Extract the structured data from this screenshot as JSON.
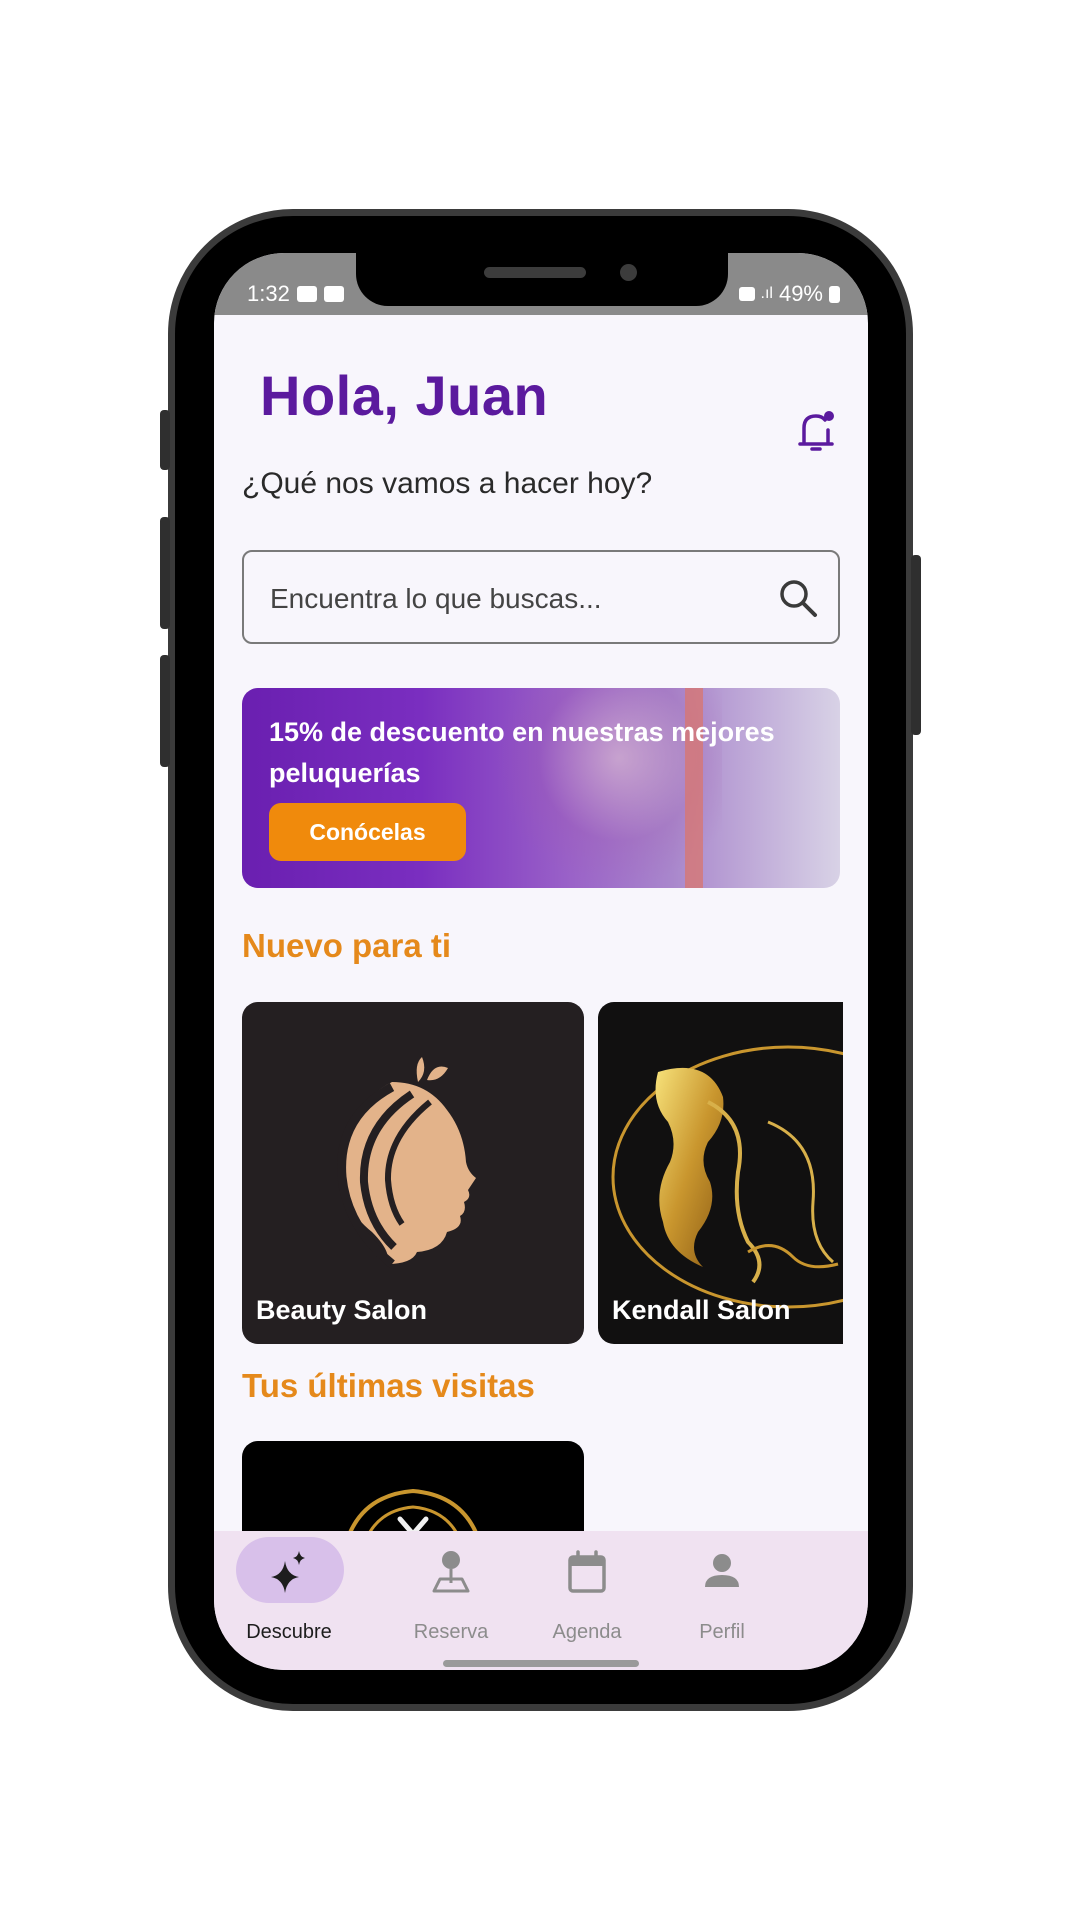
{
  "status_bar": {
    "time": "1:32",
    "battery": "49%"
  },
  "header": {
    "greeting": "Hola, Juan",
    "subtitle": "¿Qué nos vamos a hacer hoy?"
  },
  "search": {
    "placeholder": "Encuentra lo que buscas...",
    "icon": "search-icon"
  },
  "promo": {
    "text": "15% de descuento en nuestras mejores peluquerías",
    "button_label": "Conócelas"
  },
  "sections": {
    "new_for_you": "Nuevo para ti",
    "recent_visits": "Tus últimas visitas"
  },
  "new_salons": [
    {
      "name": "Beauty Salon"
    },
    {
      "name": "Kendall Salon"
    }
  ],
  "bottom_nav": {
    "items": [
      {
        "label": "Descubre",
        "icon": "sparkles-icon",
        "active": true
      },
      {
        "label": "Reserva",
        "icon": "map-pin-icon",
        "active": false
      },
      {
        "label": "Agenda",
        "icon": "calendar-icon",
        "active": false
      },
      {
        "label": "Perfil",
        "icon": "person-icon",
        "active": false
      }
    ]
  },
  "colors": {
    "brand_purple": "#5b1a9e",
    "accent_orange": "#e5891b",
    "button_orange": "#f08a0c",
    "nav_background": "#f0e2f1",
    "nav_active_pill": "#d8c0ea"
  }
}
